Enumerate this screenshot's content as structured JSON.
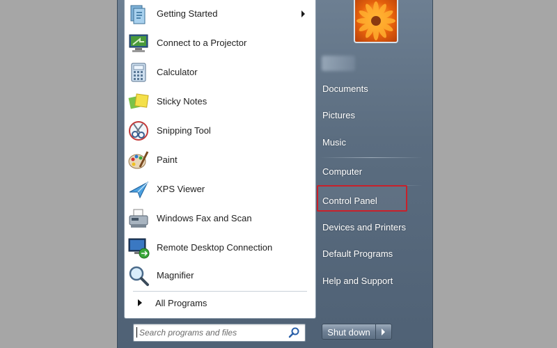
{
  "programs": [
    {
      "label": "Getting Started",
      "icon": "getting-started-icon",
      "has_submenu": true
    },
    {
      "label": "Connect to a Projector",
      "icon": "projector-icon",
      "has_submenu": false
    },
    {
      "label": "Calculator",
      "icon": "calculator-icon",
      "has_submenu": false
    },
    {
      "label": "Sticky Notes",
      "icon": "sticky-notes-icon",
      "has_submenu": false
    },
    {
      "label": "Snipping Tool",
      "icon": "snipping-tool-icon",
      "has_submenu": false
    },
    {
      "label": "Paint",
      "icon": "paint-icon",
      "has_submenu": false
    },
    {
      "label": "XPS Viewer",
      "icon": "xps-viewer-icon",
      "has_submenu": false
    },
    {
      "label": "Windows Fax and Scan",
      "icon": "fax-scan-icon",
      "has_submenu": false
    },
    {
      "label": "Remote Desktop Connection",
      "icon": "remote-desktop-icon",
      "has_submenu": false
    },
    {
      "label": "Magnifier",
      "icon": "magnifier-icon",
      "has_submenu": false
    }
  ],
  "all_programs_label": "All Programs",
  "search": {
    "placeholder": "Search programs and files",
    "value": ""
  },
  "right_items": [
    {
      "label": "Documents"
    },
    {
      "label": "Pictures"
    },
    {
      "label": "Music"
    },
    {
      "label": "Computer"
    },
    {
      "label": "Control Panel",
      "highlighted": true
    },
    {
      "label": "Devices and Printers"
    },
    {
      "label": "Default Programs"
    },
    {
      "label": "Help and Support"
    }
  ],
  "shutdown_label": "Shut down",
  "colors": {
    "highlight_border": "#c8202a",
    "menu_background": "#5b6d80",
    "desktop_background": "#a6a6a6"
  }
}
